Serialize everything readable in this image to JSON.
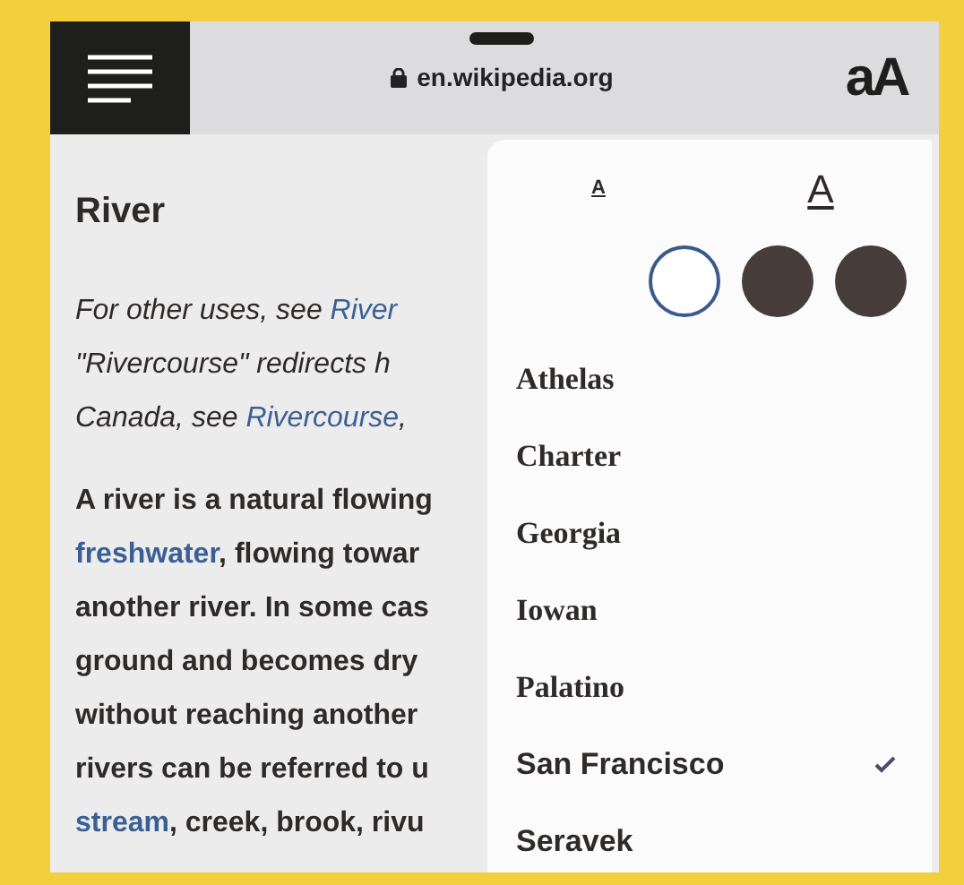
{
  "toolbar": {
    "url": "en.wikipedia.org",
    "text_button": "aA"
  },
  "article": {
    "title": "River",
    "hatnote": [
      [
        {
          "text": "For other uses, see "
        },
        {
          "text": "River",
          "link": true
        }
      ],
      [
        {
          "text": "\"Rivercourse\" redirects h"
        }
      ],
      [
        {
          "text": "Canada, see "
        },
        {
          "text": "Rivercourse",
          "link": true
        },
        {
          "text": ","
        }
      ]
    ],
    "body": [
      [
        {
          "text": "A river is a natural flowing"
        }
      ],
      [
        {
          "text": "freshwater",
          "link": true
        },
        {
          "text": ", flowing towar"
        }
      ],
      [
        {
          "text": "another river. In some cas"
        }
      ],
      [
        {
          "text": "ground and becomes dry"
        }
      ],
      [
        {
          "text": "without reaching another"
        }
      ],
      [
        {
          "text": "rivers can be referred to u"
        }
      ],
      [
        {
          "text": "stream",
          "link": true
        },
        {
          "text": ", creek, brook, rivu"
        }
      ]
    ]
  },
  "reader_settings": {
    "font_size_buttons": [
      {
        "label": "A",
        "kind": "smaller"
      },
      {
        "label": "A",
        "kind": "larger"
      }
    ],
    "themes": [
      {
        "color": "#ffffff",
        "selected": true
      },
      {
        "color": "#463c3a",
        "selected": false
      },
      {
        "color": "#463c3a",
        "selected": false
      }
    ],
    "fonts": [
      {
        "name": "Athelas",
        "kind": "serif",
        "selected": false
      },
      {
        "name": "Charter",
        "kind": "serif",
        "selected": false
      },
      {
        "name": "Georgia",
        "kind": "serif",
        "selected": false
      },
      {
        "name": "Iowan",
        "kind": "serif",
        "selected": false
      },
      {
        "name": "Palatino",
        "kind": "serif",
        "selected": false
      },
      {
        "name": "San Francisco",
        "kind": "sans",
        "selected": true
      },
      {
        "name": "Seravek",
        "kind": "sans",
        "selected": false
      }
    ]
  }
}
